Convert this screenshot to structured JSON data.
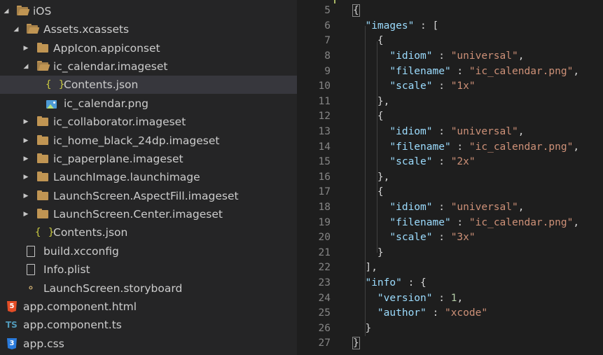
{
  "explorer": {
    "items": [
      {
        "label": "iOS",
        "icon": "folder-open-icon",
        "expanded": true
      },
      {
        "label": "Assets.xcassets",
        "icon": "folder-open-icon",
        "expanded": true
      },
      {
        "label": "AppIcon.appiconset",
        "icon": "folder-icon",
        "expanded": false
      },
      {
        "label": "ic_calendar.imageset",
        "icon": "folder-open-icon",
        "expanded": true
      },
      {
        "label": "Contents.json",
        "icon": "json-icon",
        "selected": true
      },
      {
        "label": "ic_calendar.png",
        "icon": "image-icon"
      },
      {
        "label": "ic_collaborator.imageset",
        "icon": "folder-icon",
        "expanded": false
      },
      {
        "label": "ic_home_black_24dp.imageset",
        "icon": "folder-icon",
        "expanded": false
      },
      {
        "label": "ic_paperplane.imageset",
        "icon": "folder-icon",
        "expanded": false
      },
      {
        "label": "LaunchImage.launchimage",
        "icon": "folder-icon",
        "expanded": false
      },
      {
        "label": "LaunchScreen.AspectFill.imageset",
        "icon": "folder-icon",
        "expanded": false
      },
      {
        "label": "LaunchScreen.Center.imageset",
        "icon": "folder-icon",
        "expanded": false
      },
      {
        "label": "Contents.json",
        "icon": "json-icon"
      },
      {
        "label": "build.xcconfig",
        "icon": "file-icon"
      },
      {
        "label": "Info.plist",
        "icon": "file-icon"
      },
      {
        "label": "LaunchScreen.storyboard",
        "icon": "storyboard-icon"
      },
      {
        "label": "app.component.html",
        "icon": "html-icon"
      },
      {
        "label": "app.component.ts",
        "icon": "typescript-icon"
      },
      {
        "label": "app.css",
        "icon": "css-icon"
      }
    ],
    "glyphs": {
      "json": "{ }",
      "html": "5",
      "ts": "TS",
      "css": "3",
      "storyboard": "⚬"
    }
  },
  "editor": {
    "lines": [
      {
        "num": "5"
      },
      {
        "num": "6"
      },
      {
        "num": "7"
      },
      {
        "num": "8"
      },
      {
        "num": "9"
      },
      {
        "num": "10"
      },
      {
        "num": "11"
      },
      {
        "num": "12"
      },
      {
        "num": "13"
      },
      {
        "num": "14"
      },
      {
        "num": "15"
      },
      {
        "num": "16"
      },
      {
        "num": "17"
      },
      {
        "num": "18"
      },
      {
        "num": "19"
      },
      {
        "num": "20"
      },
      {
        "num": "21"
      },
      {
        "num": "22"
      },
      {
        "num": "23"
      },
      {
        "num": "24"
      },
      {
        "num": "25"
      },
      {
        "num": "26"
      },
      {
        "num": "27"
      }
    ],
    "tokens": {
      "open_brace": "{",
      "close_brace": "}",
      "images_key": "\"images\"",
      "colon": " : ",
      "open_bracket": "[",
      "obj_open": "{",
      "obj_close": "}",
      "obj_close_comma": "},",
      "arr_close": "],",
      "idiom_key": "\"idiom\"",
      "filename_key": "\"filename\"",
      "scale_key": "\"scale\"",
      "universal": "\"universal\"",
      "png": "\"ic_calendar.png\"",
      "comma": ",",
      "scale1": "\"1x\"",
      "scale2": "\"2x\"",
      "scale3": "\"3x\"",
      "info_key": "\"info\"",
      "version_key": "\"version\"",
      "version_val": "1",
      "author_key": "\"author\"",
      "author_val": "\"xcode\"",
      "colon_brace": " : {"
    }
  }
}
